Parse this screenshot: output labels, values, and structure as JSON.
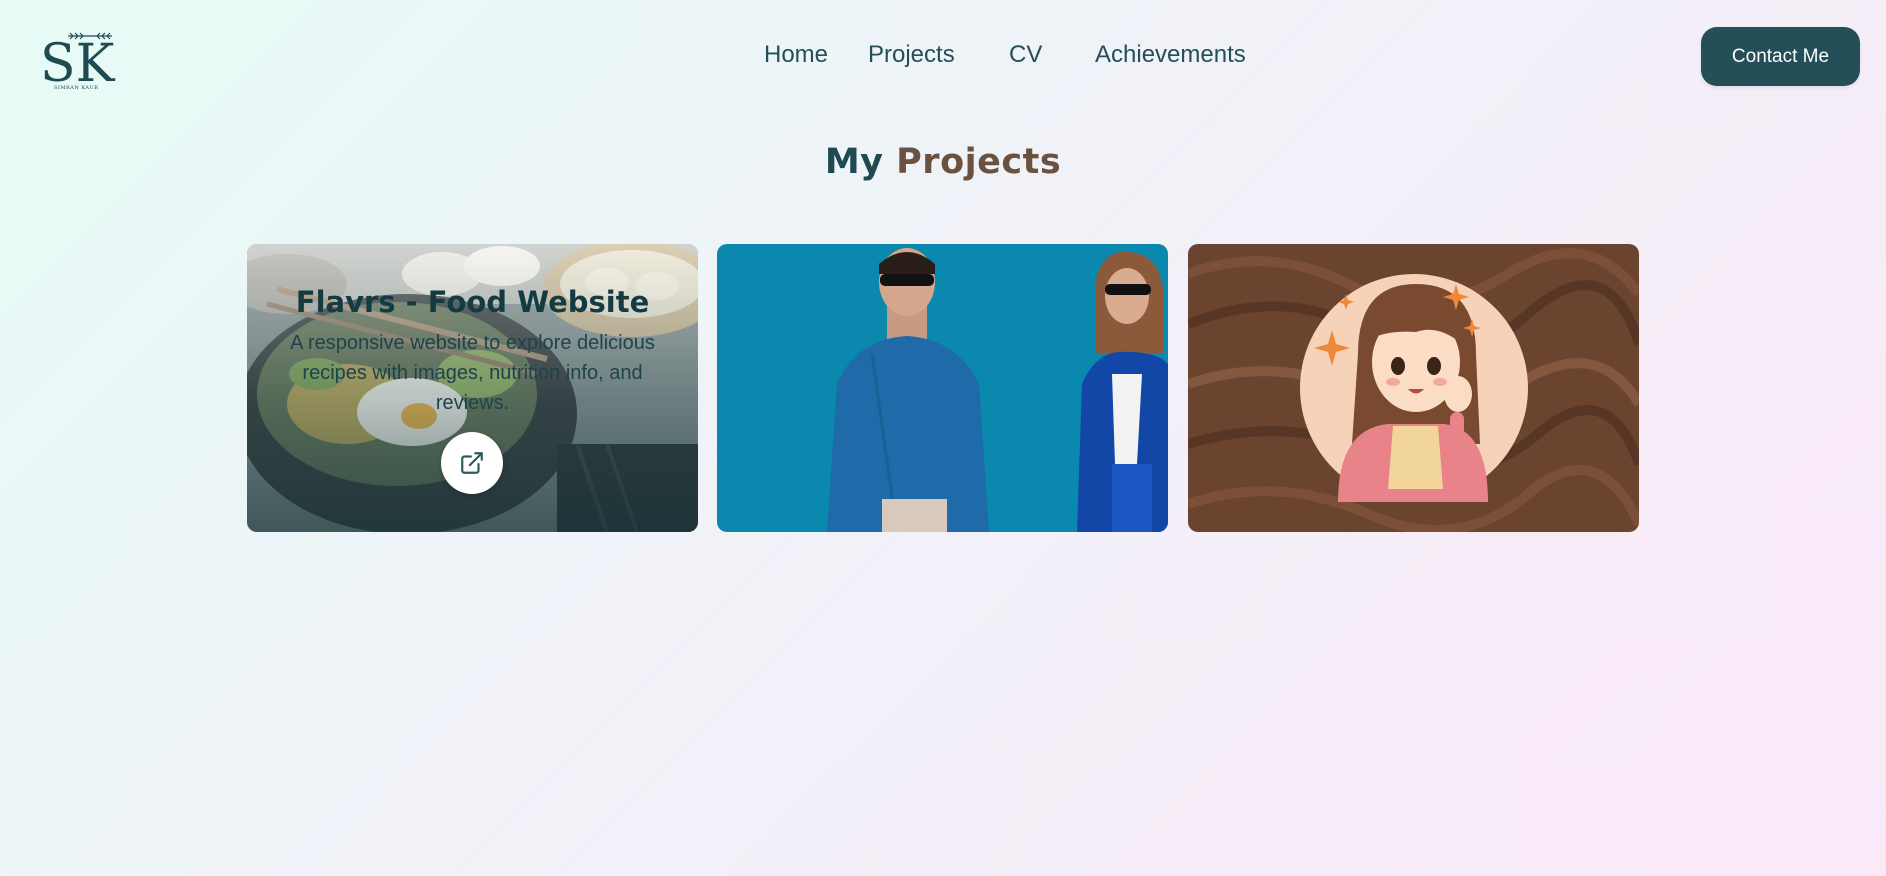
{
  "header": {
    "logo_text": "SK",
    "logo_subtext": "SIMRAN KAUR",
    "nav": [
      {
        "label": "Home"
      },
      {
        "label": "Projects"
      },
      {
        "label": "CV"
      },
      {
        "label": "Achievements"
      }
    ],
    "contact_label": "Contact Me"
  },
  "section": {
    "title_part1": "My",
    "title_part2": "Projects"
  },
  "projects": [
    {
      "title": "Flavrs - Food Website",
      "description": "A responsive website to explore delicious recipes with images, nutrition info, and reviews.",
      "link_icon": "external-link-icon",
      "image": "food-bowl-photo"
    },
    {
      "image": "fashion-models-photo"
    },
    {
      "image": "anime-girl-waving-illustration"
    }
  ],
  "colors": {
    "primary": "#244f58",
    "accent_brown": "#6b5240",
    "card2_bg": "#0a88ad",
    "card3_bg": "#6b4430"
  }
}
